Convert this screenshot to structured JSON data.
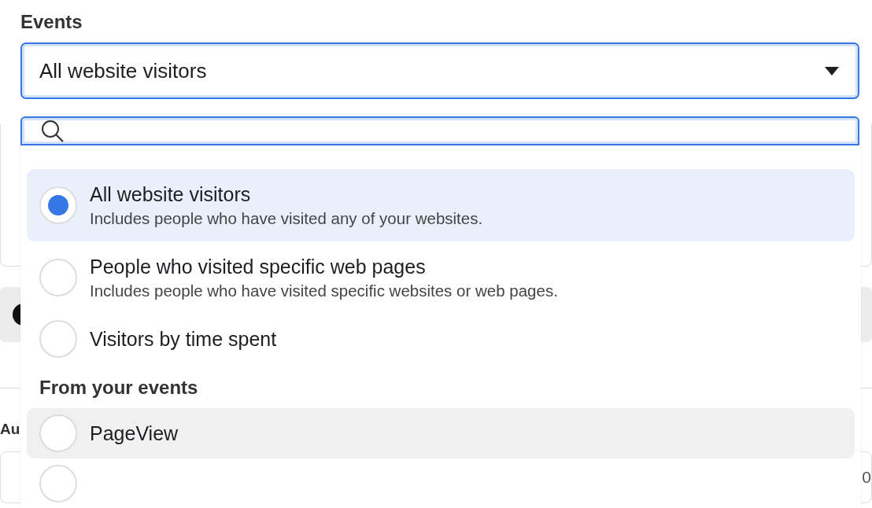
{
  "field_label": "Events",
  "select": {
    "value": "All website visitors"
  },
  "background": {
    "label": "Au",
    "value": "0"
  },
  "dropdown": {
    "items": [
      {
        "kind": "option",
        "title": "All website visitors",
        "description": "Includes people who have visited any of your websites.",
        "selected": true,
        "highlighted": false
      },
      {
        "kind": "option",
        "title": "People who visited specific web pages",
        "description": "Includes people who have visited specific websites or web pages.",
        "selected": false,
        "highlighted": false
      },
      {
        "kind": "option",
        "title": "Visitors by time spent",
        "selected": false,
        "highlighted": false
      },
      {
        "kind": "header",
        "title": "From your events"
      },
      {
        "kind": "option",
        "title": "PageView",
        "selected": false,
        "highlighted": true
      },
      {
        "kind": "option",
        "selected": false,
        "highlighted": false
      }
    ]
  }
}
